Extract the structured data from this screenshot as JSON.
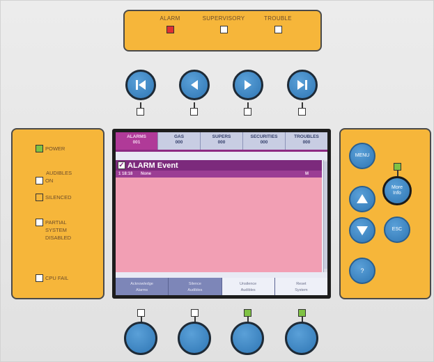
{
  "status": {
    "alarm": {
      "label": "ALARM",
      "led": "red"
    },
    "supervisory": {
      "label": "SUPERVISORY",
      "led": "off"
    },
    "trouble": {
      "label": "TROUBLE",
      "led": "off"
    }
  },
  "nav": {
    "first_icon": "skip-first-icon",
    "prev_icon": "previous-icon",
    "next_icon": "next-icon",
    "last_icon": "skip-last-icon"
  },
  "indicators": {
    "power": "POWER",
    "audibles_line1": "AUDIBLES",
    "audibles_line2": "ON",
    "silenced": "SILENCED",
    "partial_line1": "PARTIAL",
    "partial_line2": "SYSTEM",
    "partial_line3": "DISABLED",
    "cpu_fail": "CPU FAIL"
  },
  "display": {
    "tabs": [
      {
        "name": "ALARMS",
        "count": "001"
      },
      {
        "name": "GAS",
        "count": "000"
      },
      {
        "name": "SUPERS",
        "count": "000"
      },
      {
        "name": "SECURITIES",
        "count": "000"
      },
      {
        "name": "TROUBLES",
        "count": "000"
      }
    ],
    "event_title": "ALARM Event",
    "event": {
      "time": "1 18:18",
      "name": "None",
      "number": "M"
    },
    "softkeys": [
      {
        "line1": "Acknowledge",
        "line2": "Alarms"
      },
      {
        "line1": "Silence",
        "line2": "Audibles"
      },
      {
        "line1": "Unsilence",
        "line2": "Audibles"
      },
      {
        "line1": "Reset",
        "line2": "System"
      }
    ]
  },
  "controls": {
    "menu": "MENU",
    "more_info_line1": "More",
    "more_info_line2": "Info",
    "esc": "ESC",
    "help": "?"
  },
  "colors": {
    "panel_orange": "#f6b63a",
    "button_blue": "#3a86c6",
    "alarm_red": "#e03030",
    "led_green": "#7fc244",
    "tab_active": "#b03a98",
    "event_header": "#7c2a7c",
    "event_body": "#f29fb4"
  }
}
